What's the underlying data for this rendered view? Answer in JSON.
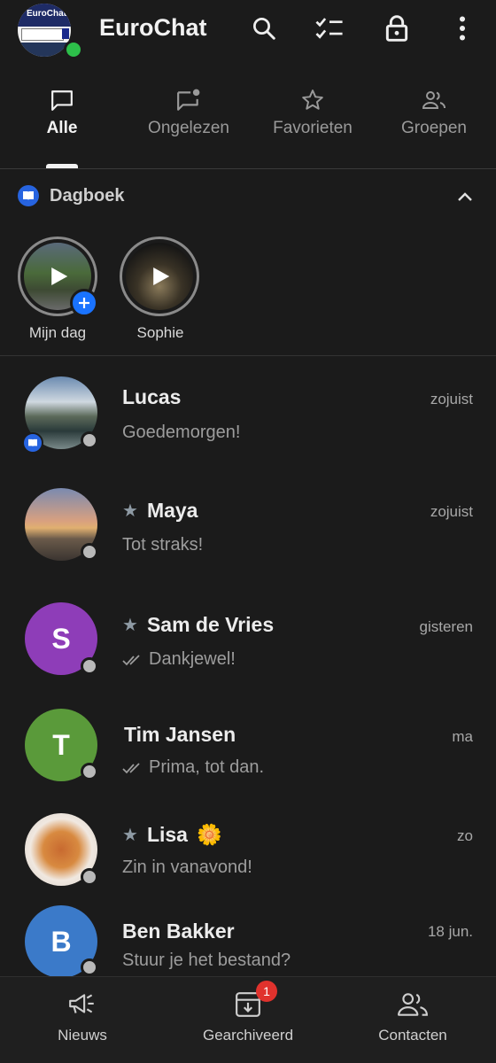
{
  "header": {
    "app_name": "EuroChat",
    "logo_text": "EuroChat"
  },
  "tabs": [
    {
      "label": "Alle",
      "active": true,
      "icon": "chat-bubble-icon"
    },
    {
      "label": "Ongelezen",
      "active": false,
      "icon": "unread-bubble-icon"
    },
    {
      "label": "Favorieten",
      "active": false,
      "icon": "star-icon"
    },
    {
      "label": "Groepen",
      "active": false,
      "icon": "group-icon"
    }
  ],
  "diary": {
    "title": "Dagboek",
    "stories": [
      {
        "label": "Mijn dag"
      },
      {
        "label": "Sophie"
      }
    ]
  },
  "chats": [
    {
      "name": "Lucas",
      "time": "zojuist",
      "message": "Goedemorgen!",
      "starred": false,
      "read_receipt": false
    },
    {
      "name": "Maya",
      "time": "zojuist",
      "message": "Tot straks!",
      "starred": true,
      "read_receipt": false
    },
    {
      "name": "Sam de Vries",
      "time": "gisteren",
      "message": "Dankjewel!",
      "starred": true,
      "read_receipt": true,
      "avatar_letter": "S",
      "avatar_color": "#8e3db8"
    },
    {
      "name": "Tim Jansen",
      "time": "ma",
      "message": "Prima, tot dan.",
      "starred": false,
      "read_receipt": true,
      "avatar_letter": "T",
      "avatar_color": "#5a9a3a"
    },
    {
      "name": "Lisa",
      "name_emoji": "🌼",
      "time": "zo",
      "message": "Zin in vanavond!",
      "starred": true,
      "read_receipt": false
    },
    {
      "name": "Ben Bakker",
      "time": "18 jun.",
      "message": "Stuur je het bestand?",
      "starred": false,
      "read_receipt": false,
      "avatar_letter": "B",
      "avatar_color": "#3b7ac9"
    }
  ],
  "bottom_nav": [
    {
      "label": "Nieuws",
      "icon": "megaphone-icon"
    },
    {
      "label": "Gearchiveerd",
      "icon": "archive-icon",
      "badge": "1"
    },
    {
      "label": "Contacten",
      "icon": "contacts-icon"
    }
  ],
  "colors": {
    "background": "#1b1b1b",
    "accent_blue": "#1a73ff",
    "online_green": "#2dbf4a",
    "badge_red": "#e0322d"
  }
}
